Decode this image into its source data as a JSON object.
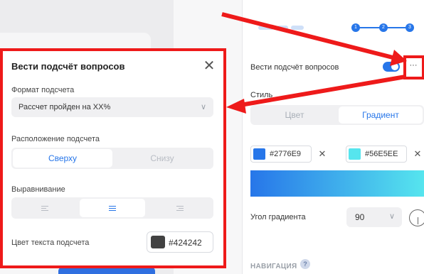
{
  "settings_panel": {
    "question_counter": {
      "label": "Вести подсчёт вопросов",
      "enabled": true,
      "more_label": "···"
    },
    "style": {
      "label": "Стиль",
      "tabs": [
        "Цвет",
        "Градиент"
      ],
      "active_tab": "Градиент"
    },
    "gradient": {
      "color1": {
        "hex": "#2776E9",
        "remove": "✕"
      },
      "color2": {
        "hex": "#56E5EE",
        "remove": "✕"
      },
      "angle_label": "Угол градиента",
      "angle_value": "90"
    },
    "navigation_header": "НАВИГАЦИЯ",
    "help_icon": "?",
    "progress_steps": [
      "1",
      "2",
      "3"
    ]
  },
  "popup": {
    "title": "Вести подсчёт вопросов",
    "close_icon": "close-icon",
    "format_label": "Формат подсчета",
    "format_value": "Рассчет пройден на XX%",
    "position_label": "Расположение подсчета",
    "position_options": [
      "Сверху",
      "Снизу"
    ],
    "position_selected": "Сверху",
    "align_label": "Выравнивание",
    "align_options": [
      "left",
      "center",
      "right"
    ],
    "align_selected": "center",
    "text_color_label": "Цвет текста подсчета",
    "text_color_hex": "#424242"
  },
  "colors": {
    "accent": "#2776E9",
    "gradient_end": "#56E5EE",
    "text_color": "#424242",
    "annotation_red": "#EE1A1A"
  }
}
